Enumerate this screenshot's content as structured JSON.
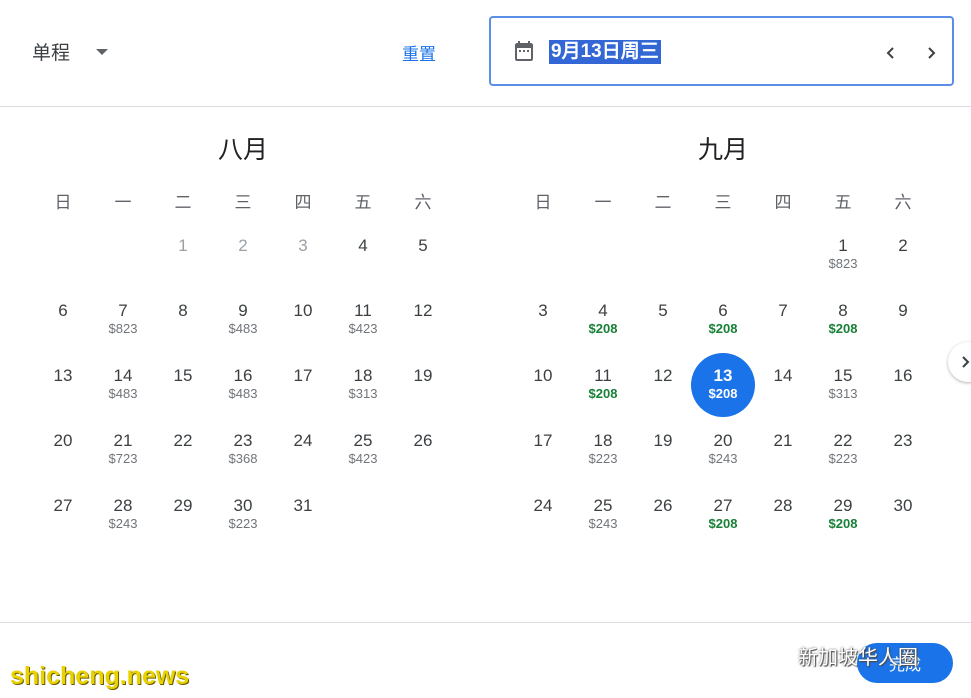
{
  "topbar": {
    "trip_type": "单程",
    "reset_label": "重置",
    "selected_date": "9月13日周三"
  },
  "icons": {
    "calendar": "calendar-icon",
    "prev": "chevron-left-icon",
    "next": "chevron-right-icon",
    "dropdown": "caret-down-icon"
  },
  "colors": {
    "accent": "#1a73e8",
    "low_price": "#188038",
    "selection_highlight": "#3367d6"
  },
  "weekdays": [
    "日",
    "一",
    "二",
    "三",
    "四",
    "五",
    "六"
  ],
  "months": [
    {
      "title": "八月",
      "days": [
        {
          "num": "",
          "price": ""
        },
        {
          "num": "",
          "price": ""
        },
        {
          "num": "1",
          "price": "",
          "disabled": true
        },
        {
          "num": "2",
          "price": "",
          "disabled": true
        },
        {
          "num": "3",
          "price": "",
          "disabled": true
        },
        {
          "num": "4",
          "price": ""
        },
        {
          "num": "5",
          "price": ""
        },
        {
          "num": "6",
          "price": ""
        },
        {
          "num": "7",
          "price": "$823"
        },
        {
          "num": "8",
          "price": ""
        },
        {
          "num": "9",
          "price": "$483"
        },
        {
          "num": "10",
          "price": ""
        },
        {
          "num": "11",
          "price": "$423"
        },
        {
          "num": "12",
          "price": ""
        },
        {
          "num": "13",
          "price": ""
        },
        {
          "num": "14",
          "price": "$483"
        },
        {
          "num": "15",
          "price": ""
        },
        {
          "num": "16",
          "price": "$483"
        },
        {
          "num": "17",
          "price": ""
        },
        {
          "num": "18",
          "price": "$313"
        },
        {
          "num": "19",
          "price": ""
        },
        {
          "num": "20",
          "price": ""
        },
        {
          "num": "21",
          "price": "$723"
        },
        {
          "num": "22",
          "price": ""
        },
        {
          "num": "23",
          "price": "$368"
        },
        {
          "num": "24",
          "price": ""
        },
        {
          "num": "25",
          "price": "$423"
        },
        {
          "num": "26",
          "price": ""
        },
        {
          "num": "27",
          "price": ""
        },
        {
          "num": "28",
          "price": "$243"
        },
        {
          "num": "29",
          "price": ""
        },
        {
          "num": "30",
          "price": "$223"
        },
        {
          "num": "31",
          "price": ""
        }
      ]
    },
    {
      "title": "九月",
      "days": [
        {
          "num": "",
          "price": ""
        },
        {
          "num": "",
          "price": ""
        },
        {
          "num": "",
          "price": ""
        },
        {
          "num": "",
          "price": ""
        },
        {
          "num": "",
          "price": ""
        },
        {
          "num": "1",
          "price": "$823"
        },
        {
          "num": "2",
          "price": ""
        },
        {
          "num": "3",
          "price": ""
        },
        {
          "num": "4",
          "price": "$208",
          "low": true
        },
        {
          "num": "5",
          "price": ""
        },
        {
          "num": "6",
          "price": "$208",
          "low": true
        },
        {
          "num": "7",
          "price": ""
        },
        {
          "num": "8",
          "price": "$208",
          "low": true
        },
        {
          "num": "9",
          "price": ""
        },
        {
          "num": "10",
          "price": ""
        },
        {
          "num": "11",
          "price": "$208",
          "low": true
        },
        {
          "num": "12",
          "price": ""
        },
        {
          "num": "13",
          "price": "$208",
          "low": true,
          "selected": true
        },
        {
          "num": "14",
          "price": ""
        },
        {
          "num": "15",
          "price": "$313"
        },
        {
          "num": "16",
          "price": ""
        },
        {
          "num": "17",
          "price": ""
        },
        {
          "num": "18",
          "price": "$223"
        },
        {
          "num": "19",
          "price": ""
        },
        {
          "num": "20",
          "price": "$243"
        },
        {
          "num": "21",
          "price": ""
        },
        {
          "num": "22",
          "price": "$223"
        },
        {
          "num": "23",
          "price": ""
        },
        {
          "num": "24",
          "price": ""
        },
        {
          "num": "25",
          "price": "$243"
        },
        {
          "num": "26",
          "price": ""
        },
        {
          "num": "27",
          "price": "$208",
          "low": true
        },
        {
          "num": "28",
          "price": ""
        },
        {
          "num": "29",
          "price": "$208",
          "low": true
        },
        {
          "num": "30",
          "price": ""
        }
      ]
    }
  ],
  "footer": {
    "done_label": "完成"
  },
  "watermarks": {
    "left": "shicheng.news",
    "right": "新加坡华人圈"
  }
}
